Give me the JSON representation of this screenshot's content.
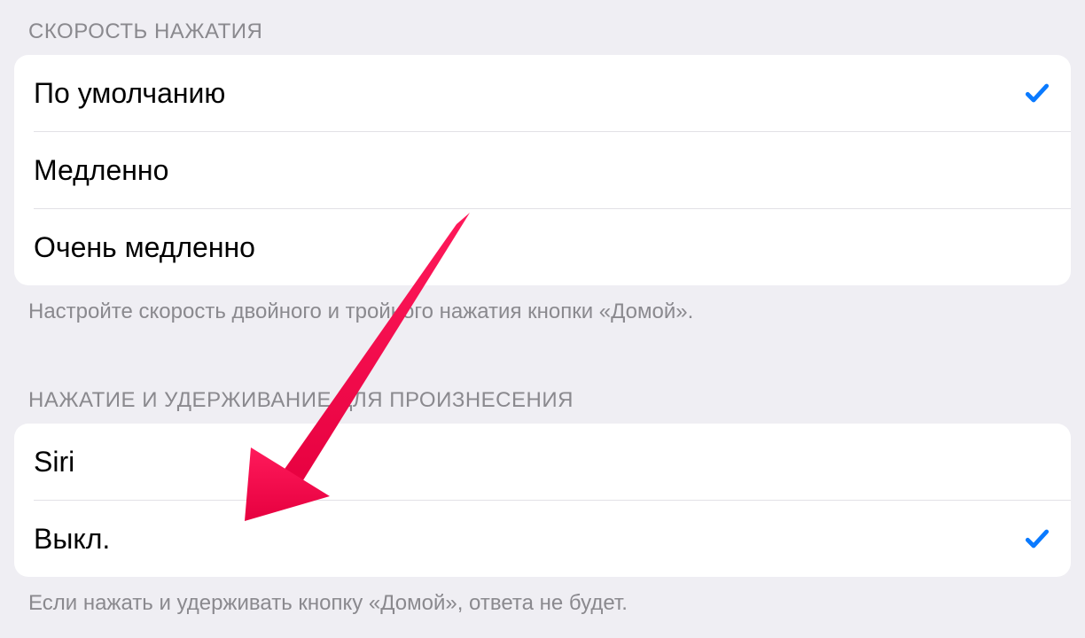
{
  "section1": {
    "header": "СКОРОСТЬ НАЖАТИЯ",
    "options": {
      "0": {
        "label": "По умолчанию",
        "selected": true
      },
      "1": {
        "label": "Медленно",
        "selected": false
      },
      "2": {
        "label": "Очень медленно",
        "selected": false
      }
    },
    "footer": "Настройте скорость двойного и тройного нажатия кнопки «Домой»."
  },
  "section2": {
    "header": "НАЖАТИЕ И УДЕРЖИВАНИЕ ДЛЯ ПРОИЗНЕСЕНИЯ",
    "options": {
      "0": {
        "label": "Siri",
        "selected": false
      },
      "1": {
        "label": "Выкл.",
        "selected": true
      }
    },
    "footer": "Если нажать и удерживать кнопку «Домой», ответа не будет."
  },
  "colors": {
    "accent": "#0a7aff",
    "arrow": "#ef1552"
  }
}
